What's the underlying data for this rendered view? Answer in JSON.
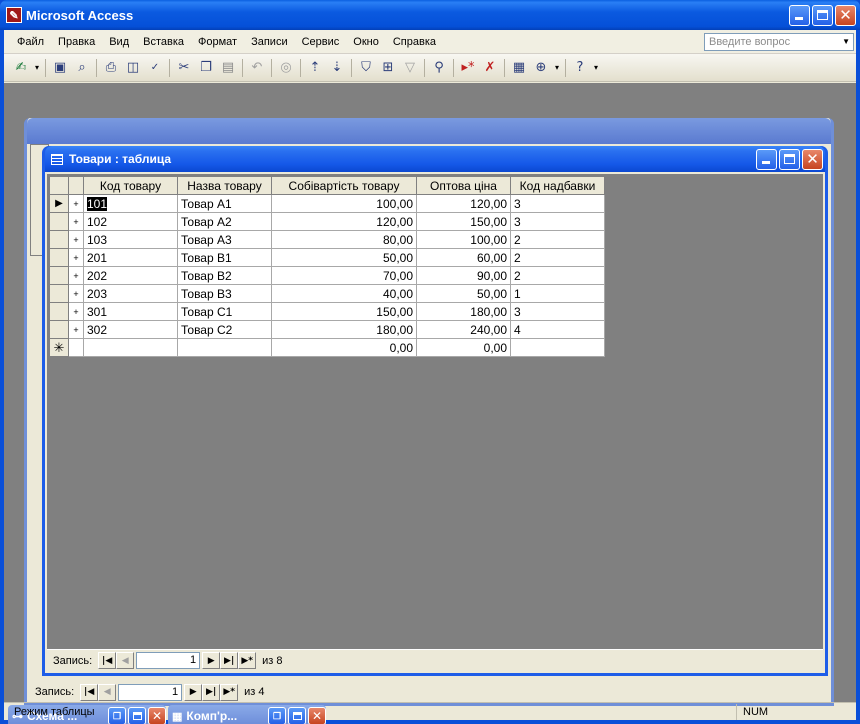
{
  "app": {
    "title": "Microsoft Access",
    "icon_glyph": "✎"
  },
  "menu": {
    "items": [
      {
        "label": "Файл"
      },
      {
        "label": "Правка"
      },
      {
        "label": "Вид"
      },
      {
        "label": "Вставка"
      },
      {
        "label": "Формат"
      },
      {
        "label": "Записи"
      },
      {
        "label": "Сервис"
      },
      {
        "label": "Окно"
      },
      {
        "label": "Справка"
      }
    ],
    "help_placeholder": "Введите вопрос"
  },
  "toolbar": {
    "icons": [
      "view-icon",
      "save-icon",
      "search-file-icon",
      "print-icon",
      "print-preview-icon",
      "spelling-icon",
      "cut-icon",
      "copy-icon",
      "paste-icon",
      "undo-icon",
      "hyperlink-icon",
      "sort-asc-icon",
      "sort-desc-icon",
      "filter-selection-icon",
      "filter-form-icon",
      "apply-filter-icon",
      "find-icon",
      "new-record-icon",
      "delete-record-icon",
      "properties-icon",
      "new-object-icon",
      "help-icon"
    ]
  },
  "front_window": {
    "title": "Товари : таблица",
    "columns": [
      "Код товару",
      "Назва товару",
      "Собівартість товару",
      "Оптова ціна",
      "Код надбавки"
    ],
    "rows": [
      {
        "code": "101",
        "name": "Товар A1",
        "cost": "100,00",
        "price": "120,00",
        "markup": "3"
      },
      {
        "code": "102",
        "name": "Товар A2",
        "cost": "120,00",
        "price": "150,00",
        "markup": "3"
      },
      {
        "code": "103",
        "name": "Товар A3",
        "cost": "80,00",
        "price": "100,00",
        "markup": "2"
      },
      {
        "code": "201",
        "name": "Товар B1",
        "cost": "50,00",
        "price": "60,00",
        "markup": "2"
      },
      {
        "code": "202",
        "name": "Товар B2",
        "cost": "70,00",
        "price": "90,00",
        "markup": "2"
      },
      {
        "code": "203",
        "name": "Товар B3",
        "cost": "40,00",
        "price": "50,00",
        "markup": "1"
      },
      {
        "code": "301",
        "name": "Товар C1",
        "cost": "150,00",
        "price": "180,00",
        "markup": "3"
      },
      {
        "code": "302",
        "name": "Товар C2",
        "cost": "180,00",
        "price": "240,00",
        "markup": "4"
      }
    ],
    "new_row": {
      "cost": "0,00",
      "price": "0,00"
    },
    "nav": {
      "label": "Запись:",
      "current": "1",
      "of_text": "из  8"
    }
  },
  "back_window": {
    "nav": {
      "label": "Запись:",
      "current": "1",
      "of_text": "из  4"
    }
  },
  "minimized": [
    {
      "title": "Схема ..."
    },
    {
      "title": "Комп'р..."
    }
  ],
  "status": {
    "mode": "Режим таблицы",
    "num": "NUM"
  }
}
